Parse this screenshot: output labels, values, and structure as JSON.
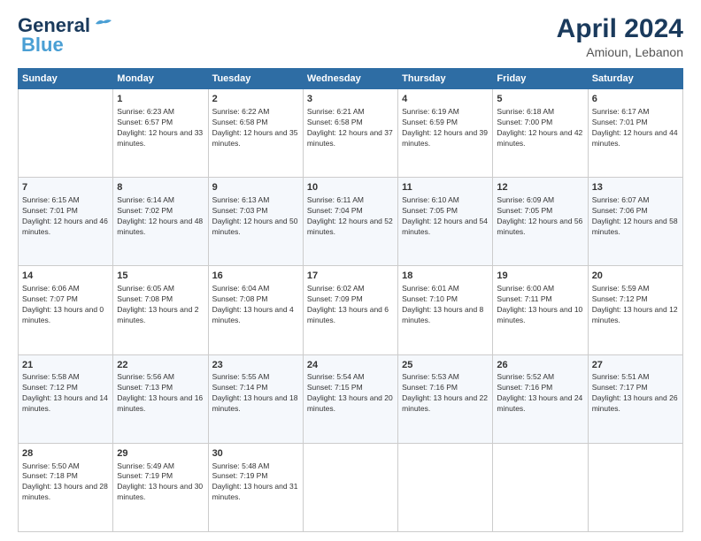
{
  "header": {
    "logo_line1": "General",
    "logo_line2": "Blue",
    "title": "April 2024",
    "location": "Amioun, Lebanon"
  },
  "days": [
    "Sunday",
    "Monday",
    "Tuesday",
    "Wednesday",
    "Thursday",
    "Friday",
    "Saturday"
  ],
  "weeks": [
    [
      {
        "date": "",
        "sunrise": "",
        "sunset": "",
        "daylight": ""
      },
      {
        "date": "1",
        "sunrise": "Sunrise: 6:23 AM",
        "sunset": "Sunset: 6:57 PM",
        "daylight": "Daylight: 12 hours and 33 minutes."
      },
      {
        "date": "2",
        "sunrise": "Sunrise: 6:22 AM",
        "sunset": "Sunset: 6:58 PM",
        "daylight": "Daylight: 12 hours and 35 minutes."
      },
      {
        "date": "3",
        "sunrise": "Sunrise: 6:21 AM",
        "sunset": "Sunset: 6:58 PM",
        "daylight": "Daylight: 12 hours and 37 minutes."
      },
      {
        "date": "4",
        "sunrise": "Sunrise: 6:19 AM",
        "sunset": "Sunset: 6:59 PM",
        "daylight": "Daylight: 12 hours and 39 minutes."
      },
      {
        "date": "5",
        "sunrise": "Sunrise: 6:18 AM",
        "sunset": "Sunset: 7:00 PM",
        "daylight": "Daylight: 12 hours and 42 minutes."
      },
      {
        "date": "6",
        "sunrise": "Sunrise: 6:17 AM",
        "sunset": "Sunset: 7:01 PM",
        "daylight": "Daylight: 12 hours and 44 minutes."
      }
    ],
    [
      {
        "date": "7",
        "sunrise": "Sunrise: 6:15 AM",
        "sunset": "Sunset: 7:01 PM",
        "daylight": "Daylight: 12 hours and 46 minutes."
      },
      {
        "date": "8",
        "sunrise": "Sunrise: 6:14 AM",
        "sunset": "Sunset: 7:02 PM",
        "daylight": "Daylight: 12 hours and 48 minutes."
      },
      {
        "date": "9",
        "sunrise": "Sunrise: 6:13 AM",
        "sunset": "Sunset: 7:03 PM",
        "daylight": "Daylight: 12 hours and 50 minutes."
      },
      {
        "date": "10",
        "sunrise": "Sunrise: 6:11 AM",
        "sunset": "Sunset: 7:04 PM",
        "daylight": "Daylight: 12 hours and 52 minutes."
      },
      {
        "date": "11",
        "sunrise": "Sunrise: 6:10 AM",
        "sunset": "Sunset: 7:05 PM",
        "daylight": "Daylight: 12 hours and 54 minutes."
      },
      {
        "date": "12",
        "sunrise": "Sunrise: 6:09 AM",
        "sunset": "Sunset: 7:05 PM",
        "daylight": "Daylight: 12 hours and 56 minutes."
      },
      {
        "date": "13",
        "sunrise": "Sunrise: 6:07 AM",
        "sunset": "Sunset: 7:06 PM",
        "daylight": "Daylight: 12 hours and 58 minutes."
      }
    ],
    [
      {
        "date": "14",
        "sunrise": "Sunrise: 6:06 AM",
        "sunset": "Sunset: 7:07 PM",
        "daylight": "Daylight: 13 hours and 0 minutes."
      },
      {
        "date": "15",
        "sunrise": "Sunrise: 6:05 AM",
        "sunset": "Sunset: 7:08 PM",
        "daylight": "Daylight: 13 hours and 2 minutes."
      },
      {
        "date": "16",
        "sunrise": "Sunrise: 6:04 AM",
        "sunset": "Sunset: 7:08 PM",
        "daylight": "Daylight: 13 hours and 4 minutes."
      },
      {
        "date": "17",
        "sunrise": "Sunrise: 6:02 AM",
        "sunset": "Sunset: 7:09 PM",
        "daylight": "Daylight: 13 hours and 6 minutes."
      },
      {
        "date": "18",
        "sunrise": "Sunrise: 6:01 AM",
        "sunset": "Sunset: 7:10 PM",
        "daylight": "Daylight: 13 hours and 8 minutes."
      },
      {
        "date": "19",
        "sunrise": "Sunrise: 6:00 AM",
        "sunset": "Sunset: 7:11 PM",
        "daylight": "Daylight: 13 hours and 10 minutes."
      },
      {
        "date": "20",
        "sunrise": "Sunrise: 5:59 AM",
        "sunset": "Sunset: 7:12 PM",
        "daylight": "Daylight: 13 hours and 12 minutes."
      }
    ],
    [
      {
        "date": "21",
        "sunrise": "Sunrise: 5:58 AM",
        "sunset": "Sunset: 7:12 PM",
        "daylight": "Daylight: 13 hours and 14 minutes."
      },
      {
        "date": "22",
        "sunrise": "Sunrise: 5:56 AM",
        "sunset": "Sunset: 7:13 PM",
        "daylight": "Daylight: 13 hours and 16 minutes."
      },
      {
        "date": "23",
        "sunrise": "Sunrise: 5:55 AM",
        "sunset": "Sunset: 7:14 PM",
        "daylight": "Daylight: 13 hours and 18 minutes."
      },
      {
        "date": "24",
        "sunrise": "Sunrise: 5:54 AM",
        "sunset": "Sunset: 7:15 PM",
        "daylight": "Daylight: 13 hours and 20 minutes."
      },
      {
        "date": "25",
        "sunrise": "Sunrise: 5:53 AM",
        "sunset": "Sunset: 7:16 PM",
        "daylight": "Daylight: 13 hours and 22 minutes."
      },
      {
        "date": "26",
        "sunrise": "Sunrise: 5:52 AM",
        "sunset": "Sunset: 7:16 PM",
        "daylight": "Daylight: 13 hours and 24 minutes."
      },
      {
        "date": "27",
        "sunrise": "Sunrise: 5:51 AM",
        "sunset": "Sunset: 7:17 PM",
        "daylight": "Daylight: 13 hours and 26 minutes."
      }
    ],
    [
      {
        "date": "28",
        "sunrise": "Sunrise: 5:50 AM",
        "sunset": "Sunset: 7:18 PM",
        "daylight": "Daylight: 13 hours and 28 minutes."
      },
      {
        "date": "29",
        "sunrise": "Sunrise: 5:49 AM",
        "sunset": "Sunset: 7:19 PM",
        "daylight": "Daylight: 13 hours and 30 minutes."
      },
      {
        "date": "30",
        "sunrise": "Sunrise: 5:48 AM",
        "sunset": "Sunset: 7:19 PM",
        "daylight": "Daylight: 13 hours and 31 minutes."
      },
      {
        "date": "",
        "sunrise": "",
        "sunset": "",
        "daylight": ""
      },
      {
        "date": "",
        "sunrise": "",
        "sunset": "",
        "daylight": ""
      },
      {
        "date": "",
        "sunrise": "",
        "sunset": "",
        "daylight": ""
      },
      {
        "date": "",
        "sunrise": "",
        "sunset": "",
        "daylight": ""
      }
    ]
  ]
}
